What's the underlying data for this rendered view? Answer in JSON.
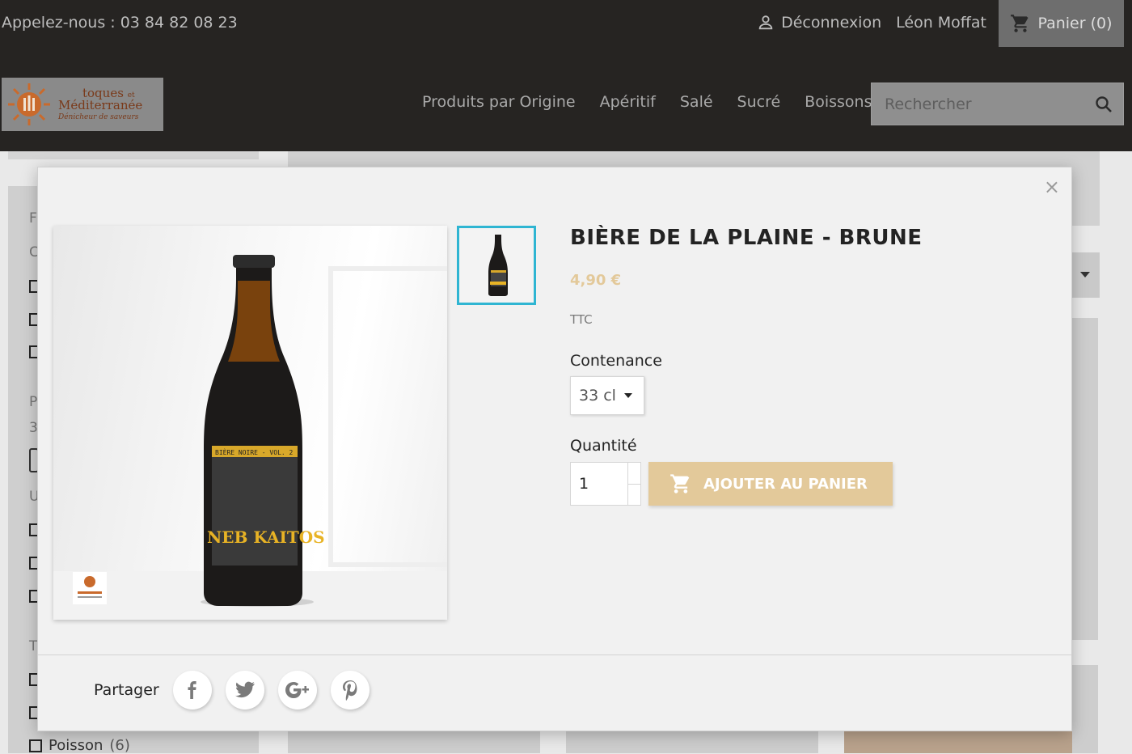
{
  "header": {
    "phone": "Appelez-nous : 03 84 82 08 23",
    "logout": "Déconnexion",
    "user_name": "Léon Moffat",
    "cart": "Panier (0)",
    "logo": {
      "line1": "toques",
      "line1b": "et",
      "line2": "Méditerranée",
      "line3": "Dénicheur de saveurs"
    },
    "nav": [
      "Produits par Origine",
      "Apéritif",
      "Salé",
      "Sucré",
      "Boissons"
    ],
    "search_placeholder": "Rechercher"
  },
  "background": {
    "letters": [
      "F",
      "C",
      "P",
      "3",
      "U",
      "T"
    ],
    "bottom_item": "Poisson",
    "bottom_item_count": "(6)"
  },
  "modal": {
    "close": "×",
    "title": "BIÈRE DE LA PLAINE - BRUNE",
    "price": "4,90 €",
    "tax": "TTC",
    "contenance_label": "Contenance",
    "contenance_value": "33 cl",
    "quantite_label": "Quantité",
    "quantite_value": "1",
    "add_to_cart": "AJOUTER AU PANIER",
    "share_label": "Partager",
    "image_label": {
      "top": "BIÈRE NOIRE - VOL. 2",
      "name": "NEB KAITOS"
    },
    "social": [
      "facebook",
      "twitter",
      "google-plus",
      "pinterest"
    ]
  },
  "colors": {
    "header_bg": "#262422",
    "accent": "#e3c99a",
    "thumb_border": "#2fb5d2"
  }
}
